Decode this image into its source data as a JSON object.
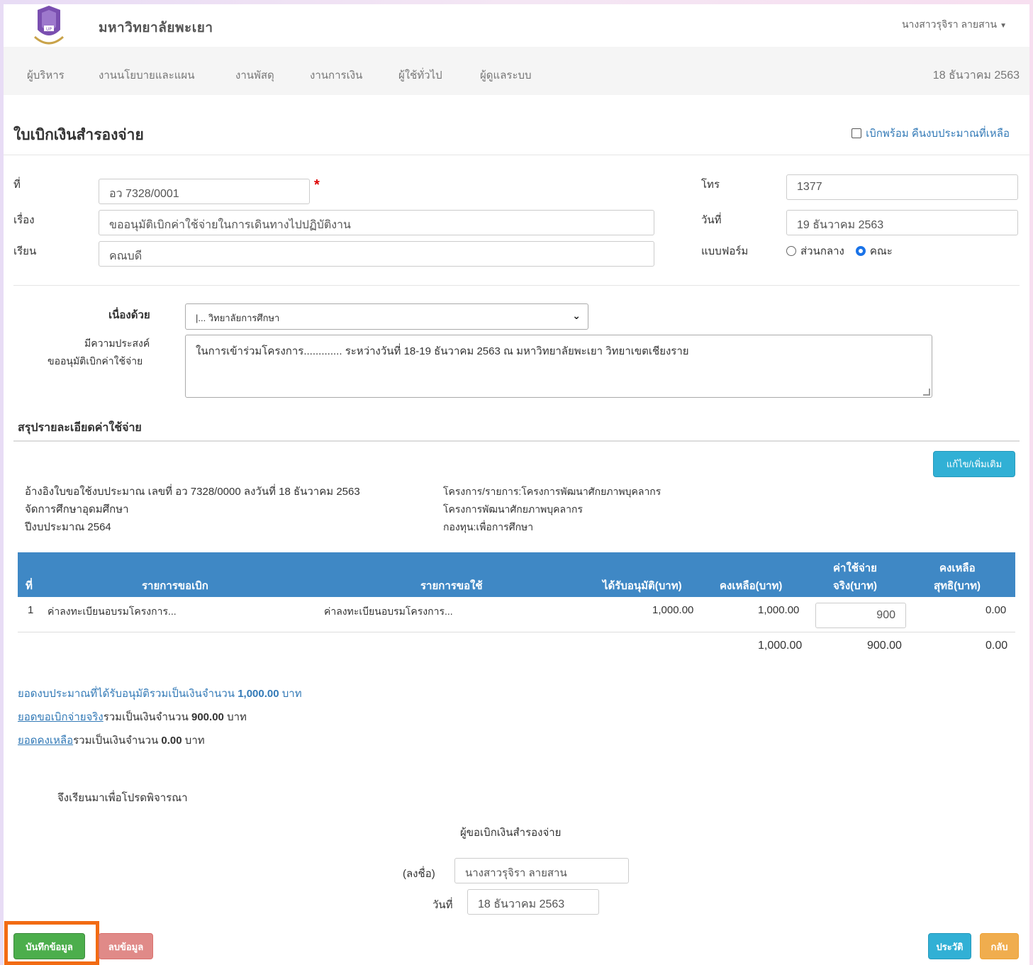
{
  "header": {
    "university": "มหาวิทยาลัยพะเยา",
    "user": "นางสาวรุจิรา ลายสาน",
    "logo_icon": "university-logo"
  },
  "nav": {
    "items": [
      "ผู้บริหาร",
      "งานนโยบายและแผน",
      "งานพัสดุ",
      "งานการเงิน",
      "ผู้ใช้ทั่วไป",
      "ผู้ดูแลระบบ"
    ],
    "date": "18 ธันวาคม 2563"
  },
  "form": {
    "title": "ใบเบิกเงินสำรองจ่าย",
    "return_budget_checkbox": "เบิกพร้อม คืนงบประมาณที่เหลือ",
    "no_label": "ที่",
    "no_value": "อว 7328/0001",
    "subject_label": "เรื่อง",
    "subject_value": "ขออนุมัติเบิกค่าใช้จ่ายในการเดินทางไปปฏิบัติงาน",
    "to_label": "เรียน",
    "to_value": "คณบดี",
    "tel_label": "โทร",
    "tel_value": "1377",
    "date_label": "วันที่",
    "date_value": "19 ธันวาคม 2563",
    "form_type_label": "แบบฟอร์ม",
    "form_type_options": [
      "ส่วนกลาง",
      "คณะ"
    ],
    "form_type_selected": "คณะ",
    "because_label": "เนื่องด้วย",
    "because_value": "|... วิทยาลัยการศึกษา",
    "purpose_label_1": "มีความประสงค์",
    "purpose_label_2": "ขออนุมัติเบิกค่าใช้จ่าย",
    "purpose_value": "ในการเข้าร่วมโครงการ............. ระหว่างวันที่ 18-19 ธันวาคม 2563 ณ มหาวิทยาลัยพะเยา วิทยาเขตเชียงราย"
  },
  "summary": {
    "title": "สรุปรายละเอียดค่าใช้จ่าย",
    "edit_button": "แก้ไข/เพิ่มเติม",
    "ref_left": [
      "อ้างอิงใบขอใช้งบประมาณ เลขที่ อว 7328/0000 ลงวันที่ 18 ธันวาคม 2563",
      "จัดการศึกษาอุดมศึกษา",
      "ปีงบประมาณ 2564"
    ],
    "ref_right": [
      "โครงการ/รายการ:โครงการพัฒนาศักยภาพบุคลากร",
      "โครงการพัฒนาศักยภาพบุคลากร",
      "กองทุน:เพื่อการศึกษา"
    ],
    "table": {
      "headers": {
        "no": "ที่",
        "withdraw_item": "รายการขอเบิก",
        "use_item": "รายการขอใช้",
        "approved": "ได้รับอนุมัติ(บาท)",
        "remaining": "คงเหลือ(บาท)",
        "actual_1": "ค่าใช้จ่าย",
        "actual_2": "จริง(บาท)",
        "net_1": "คงเหลือ",
        "net_2": "สุทธิ(บาท)"
      },
      "row": {
        "no": "1",
        "withdraw_item": "ค่าลงทะเบียนอบรมโครงการ...",
        "use_item": "ค่าลงทะเบียนอบรมโครงการ...",
        "approved": "1,000.00",
        "remaining": "1,000.00",
        "actual": "900",
        "net": "0.00"
      },
      "totals": {
        "remaining": "1,000.00",
        "actual": "900.00",
        "net": "0.00"
      }
    },
    "line1_text": "ยอดงบประมาณที่ได้รับอนุมัติรวมเป็นเงินจำนวน",
    "line1_amount": "1,000.00",
    "line2_link": "ยอดขอเบิกจ่ายจริง",
    "line2_text": "รวมเป็นเงินจำนวน",
    "line2_amount": "900.00",
    "line3_link": "ยอดคงเหลือ",
    "line3_text": "รวมเป็นเงินจำนวน",
    "line3_amount": "0.00",
    "baht": "บาท"
  },
  "signature": {
    "closing": "จึงเรียนมาเพื่อโปรดพิจารณา",
    "requester_title": "ผู้ขอเบิกเงินสำรองจ่าย",
    "sign_label": "(ลงชื่อ)",
    "sign_value": "นางสาวรุจิรา ลายสาน",
    "date_label": "วันที่",
    "date_value": "18 ธันวาคม 2563"
  },
  "buttons": {
    "save": "บันทึกข้อมูล",
    "delete": "ลบข้อมูล",
    "history": "ประวัติ",
    "back": "กลับ"
  },
  "colors": {
    "table_header": "#3f88c5",
    "save": "#4cae4c",
    "highlight_frame": "#f26b13",
    "link": "#337ab7"
  }
}
